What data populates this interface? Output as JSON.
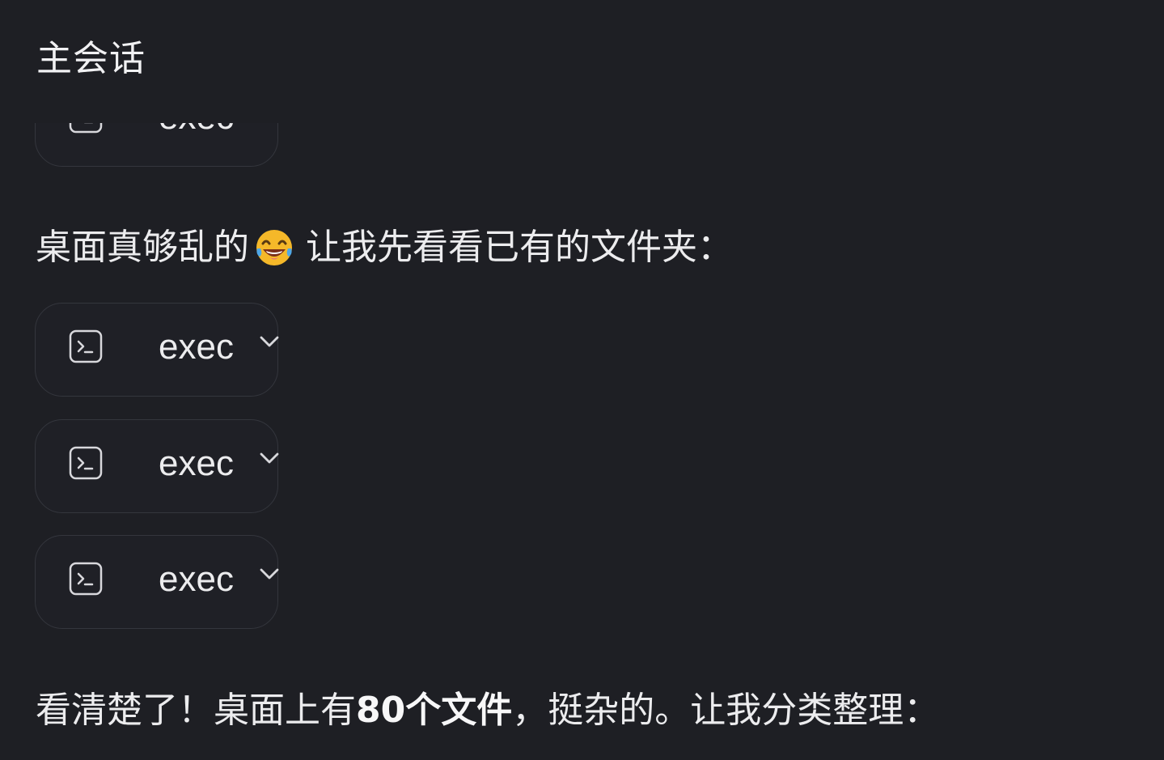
{
  "header": {
    "title": "主会话"
  },
  "tool_label": "exec",
  "messages": [
    {
      "before_emoji": "桌面真够乱的",
      "emoji": "face-with-tears-of-joy-icon",
      "after_emoji": "让我先看看已有的文件夹："
    },
    {
      "part1": "看清楚了！桌面上有 ",
      "bold": "80个文件",
      "part2": "，挺杂的。让我分类整理："
    }
  ],
  "tool_calls": [
    {
      "label": "exec"
    },
    {
      "label": "exec"
    },
    {
      "label": "exec"
    },
    {
      "label": "exec"
    }
  ],
  "colors": {
    "background": "#1e1f24",
    "card_border": "#34363d",
    "text": "#ececee"
  }
}
